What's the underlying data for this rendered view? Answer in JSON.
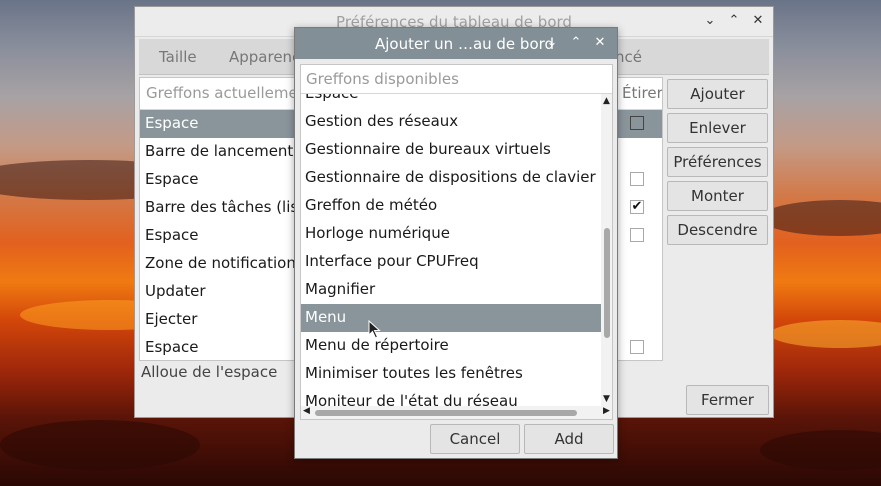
{
  "colors": {
    "titlebar_active": "#838f96",
    "selection": "#8a959b",
    "window_bg": "#ebebeb"
  },
  "back_window": {
    "title": "Préférences du tableau de bord",
    "tabs": [
      "Taille",
      "Apparenc",
      "ncé"
    ],
    "list_header": "Greffons actuellemen",
    "list_header_right": "Étirer",
    "items": [
      {
        "label": "Espace",
        "stretch": "unchecked",
        "selected": true
      },
      {
        "label": "Barre de lancement d",
        "stretch": "none",
        "selected": false
      },
      {
        "label": "Espace",
        "stretch": "unchecked",
        "selected": false
      },
      {
        "label": "Barre des tâches (liste",
        "stretch": "checked",
        "selected": false
      },
      {
        "label": "Espace",
        "stretch": "unchecked",
        "selected": false
      },
      {
        "label": "Zone de notification",
        "stretch": "none",
        "selected": false
      },
      {
        "label": "Updater",
        "stretch": "none",
        "selected": false
      },
      {
        "label": "Ejecter",
        "stretch": "none",
        "selected": false
      },
      {
        "label": "Espace",
        "stretch": "unchecked",
        "selected": false
      }
    ],
    "status": "Alloue de l'espace",
    "buttons": {
      "add": "Ajouter",
      "remove": "Enlever",
      "preferences": "Préférences",
      "up": "Monter",
      "down": "Descendre",
      "close": "Fermer"
    },
    "check_mark": "✔"
  },
  "dialog": {
    "title": "Ajouter un …au de bord",
    "list_header": "Greffons disponibles",
    "items": [
      {
        "label": "Espace",
        "selected": false
      },
      {
        "label": "Gestion des réseaux",
        "selected": false
      },
      {
        "label": "Gestionnaire de bureaux virtuels",
        "selected": false
      },
      {
        "label": "Gestionnaire de dispositions de clavier",
        "selected": false
      },
      {
        "label": "Greffon de météo",
        "selected": false
      },
      {
        "label": "Horloge numérique",
        "selected": false
      },
      {
        "label": "Interface pour CPUFreq",
        "selected": false
      },
      {
        "label": "Magnifier",
        "selected": false
      },
      {
        "label": "Menu",
        "selected": true
      },
      {
        "label": "Menu de répertoire",
        "selected": false
      },
      {
        "label": "Minimiser toutes les fenêtres",
        "selected": false
      },
      {
        "label": "Moniteur de l'état du réseau",
        "selected": false
      }
    ],
    "buttons": {
      "cancel": "Cancel",
      "add": "Add"
    }
  },
  "icons": {
    "minimize": "⌄",
    "maximize": "⌃",
    "close": "✕",
    "scroll_up": "▲",
    "scroll_down": "▼",
    "scroll_left": "◀",
    "scroll_right": "▶"
  }
}
